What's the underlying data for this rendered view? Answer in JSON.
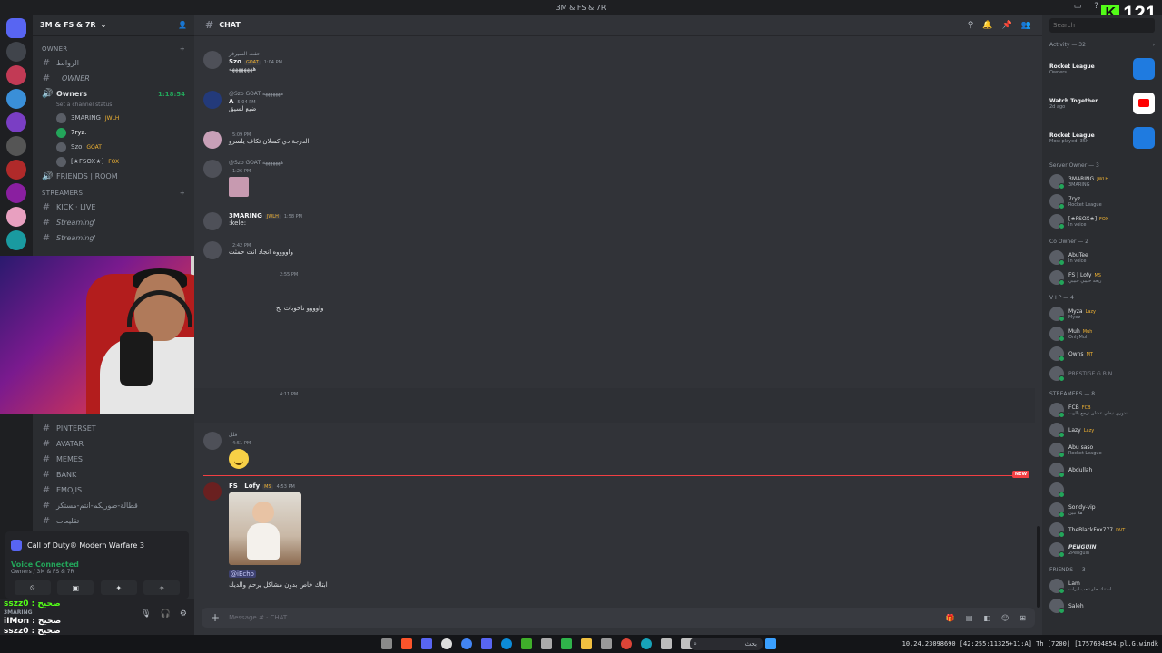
{
  "window": {
    "title": "3M & FS & 7R"
  },
  "kick": {
    "label": "K",
    "count": "121"
  },
  "server": {
    "name": "3M & FS & 7R"
  },
  "sidebar": {
    "cat_owner": "owner",
    "ch_top": "الروابط",
    "ch_owner_label": "OWNER",
    "voice_owners": "Owners",
    "voice_timer": "1:18:54",
    "voice_status": "Set a channel status",
    "users": [
      {
        "name": "3MARING",
        "tag": "JWLH"
      },
      {
        "name": "7ryz.",
        "tag": ""
      },
      {
        "name": "Szo",
        "tag": "GOAT"
      },
      {
        "name": "[★FSOX★]",
        "tag": "FOX"
      }
    ],
    "friends_room": "FRIENDS | ROOM",
    "cat_streamers": "STREAMERS",
    "kick_live": "KICK · LIVE",
    "streaming1": "Streaming'",
    "streaming2": "Streaming'",
    "channels": [
      {
        "label": "PINTERSET"
      },
      {
        "label": "AVATAR"
      },
      {
        "label": "MEMES"
      },
      {
        "label": "BANK"
      },
      {
        "label": "EMOJIS"
      },
      {
        "label": "قطالة-صوريكم-انتم-مستكر"
      },
      {
        "label": "تقليعات"
      }
    ]
  },
  "voice_panel": {
    "game": "Call of Duty® Modern Warfare 3",
    "connected": "Voice Connected",
    "sub": "Owners / 3M & FS & 7R"
  },
  "user_area": {
    "line1": "sszz0 : صحيح",
    "line2": "3MARING",
    "line3": "iIMon : صحيح",
    "line4": "sszz0 : صحيح"
  },
  "chat": {
    "channel": "CHAT",
    "messages": [
      {
        "reply": "حفت السيرفر",
        "name": "Szo",
        "badge": "GOAT",
        "time": "1:04 PM",
        "text": "ههههههههه"
      },
      {
        "reply": "@Szo GOAT هههههههه",
        "name": "A",
        "badge": "",
        "time": "5:04 PM",
        "text": "ضبع لسيق"
      },
      {
        "reply": "",
        "name": "",
        "badge": "",
        "time": "5:09 PM",
        "text": "الدرجة دي كسلان تكاف يلسرو"
      },
      {
        "reply": "@Szo GOAT هههههههه",
        "name": "",
        "badge": "",
        "time": "1:26 PM",
        "text": ""
      },
      {
        "reply": "",
        "name": "3MARING",
        "badge": "JWLH",
        "time": "1:58 PM",
        "text": ":kele:"
      },
      {
        "reply": "",
        "name": "",
        "badge": "",
        "time": "2:42 PM",
        "text": "واووووه انجاد انت حمثت"
      },
      {
        "reply": "",
        "name": "",
        "badge": "",
        "time": "2:55 PM",
        "text": "واوووو ناخوبات بح"
      },
      {
        "reply": "",
        "name": "",
        "badge": "",
        "time": "4:11 PM",
        "text": ""
      },
      {
        "reply": "فلل",
        "name": "",
        "badge": "",
        "time": "4:51 PM",
        "text": ""
      },
      {
        "reply": "",
        "name": "FS | Lofy",
        "badge": "MS",
        "time": "4:53 PM",
        "text": "ابتاك خاص بدون مشاكل يرحم والديك",
        "mention": "@iEcho"
      }
    ],
    "new_label": "NEW",
    "composer_placeholder": "Message # · CHAT"
  },
  "members": {
    "search_placeholder": "Search",
    "activity_header": "Activity — 32",
    "activities": [
      {
        "title": "Rocket League",
        "sub": "Owners"
      },
      {
        "title": "Watch Together",
        "sub": "2d ago"
      },
      {
        "title": "Rocket League",
        "sub": "Most played: 35h"
      }
    ],
    "groups": [
      {
        "title": "Server Owner — 3",
        "items": [
          {
            "name": "3MARING",
            "status": "3MARING",
            "tag": "JWLH"
          },
          {
            "name": "7ryz.",
            "status": "Rocket League",
            "tag": ""
          },
          {
            "name": "[★FSOX★]",
            "status": "In voice",
            "tag": "FOX"
          }
        ]
      },
      {
        "title": "Co Owner — 2",
        "items": [
          {
            "name": "AbuTee",
            "status": "In voice",
            "tag": ""
          },
          {
            "name": "FS | Lofy",
            "status": "ريحه حبيبي حبيبي",
            "tag": "MS"
          }
        ]
      },
      {
        "title": "V I P — 4",
        "items": [
          {
            "name": "Myza",
            "status": "Myez",
            "tag": "Lazy"
          },
          {
            "name": "Muh",
            "status": "OnlyMuh",
            "tag": "Muh"
          },
          {
            "name": "Owns",
            "status": "",
            "tag": "MT"
          },
          {
            "name": "PRESTIGE G.B.N",
            "status": "",
            "tag": ""
          }
        ]
      },
      {
        "title": "STREAMERS — 8",
        "items": [
          {
            "name": "FCB",
            "status": "ندوري نيفلي عشان نرجع بالوت",
            "tag": "FCB"
          },
          {
            "name": "Lazy",
            "status": "",
            "tag": "Lazy"
          },
          {
            "name": "Abu saso",
            "status": "Rocket League",
            "tag": ""
          },
          {
            "name": "Abdullah",
            "status": "",
            "tag": ""
          },
          {
            "name": "",
            "status": "",
            "tag": ""
          },
          {
            "name": "Sondy-vip",
            "status": "هلا نبين",
            "tag": ""
          },
          {
            "name": "TheBlackFox777",
            "status": "",
            "tag": "DVT"
          },
          {
            "name": "PENGUIN",
            "status": "2Penguin",
            "tag": ""
          }
        ]
      },
      {
        "title": "FRIENDS — 3",
        "items": [
          {
            "name": "Lam",
            "status": "استنك حلو تتعب ابرلت",
            "tag": ""
          },
          {
            "name": "Saleh",
            "status": "",
            "tag": ""
          }
        ]
      }
    ]
  },
  "taskbar": {
    "search": "بحث",
    "right_text": "10.24.23098690 [42:255:11325+11:A] Th [7200] [1757604854.pl.G.windk"
  },
  "colors": {
    "accent": "#5865f2",
    "online": "#23a55a",
    "new": "#f23f43",
    "kick": "#53fc18"
  }
}
